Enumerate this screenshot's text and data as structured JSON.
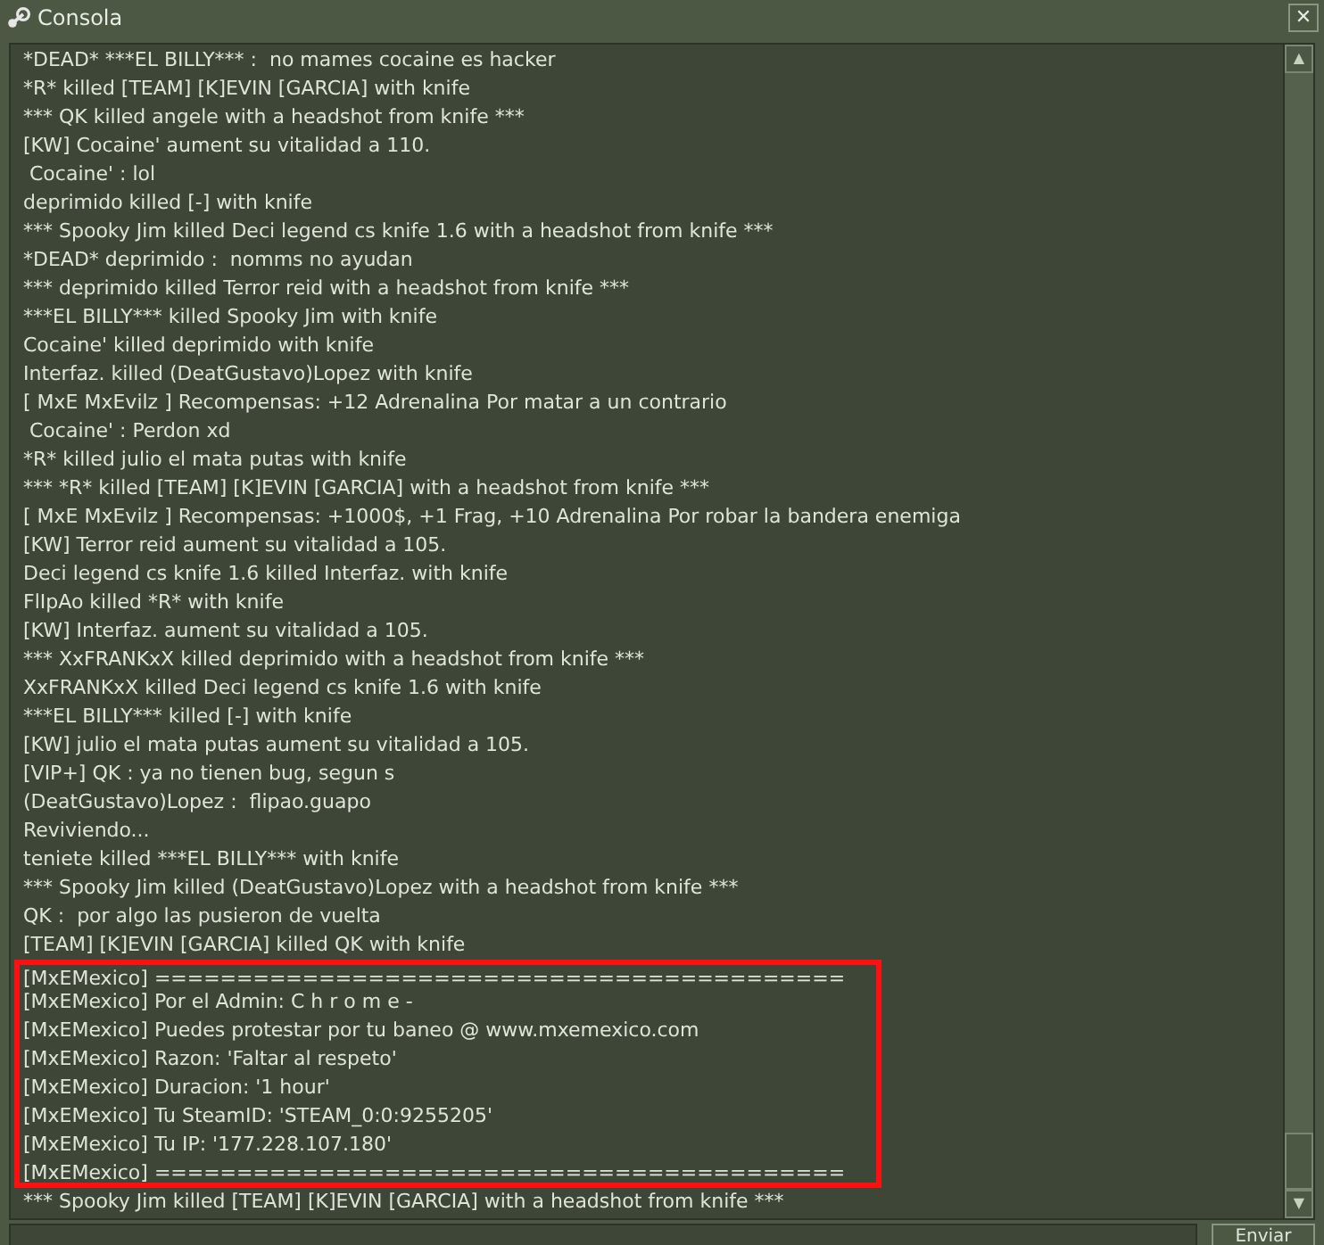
{
  "window": {
    "title": "Consola",
    "close": "✕"
  },
  "console_lines": [
    {
      "text": "*DEAD* ***EL BILLY*** :  no mames cocaine es hacker",
      "highlighted": false
    },
    {
      "text": "*R* killed [TEAM] [K]EVIN [GARCIA] with knife",
      "highlighted": false
    },
    {
      "text": "*** QK killed angele with a headshot from knife ***",
      "highlighted": false
    },
    {
      "text": "[KW] Cocaine' aument su vitalidad a 110.",
      "highlighted": false
    },
    {
      "text": " Cocaine' : lol",
      "highlighted": false
    },
    {
      "text": "deprimido killed [-] with knife",
      "highlighted": false
    },
    {
      "text": "*** Spooky Jim killed Deci legend cs knife 1.6 with a headshot from knife ***",
      "highlighted": false
    },
    {
      "text": "*DEAD* deprimido :  nomms no ayudan",
      "highlighted": false
    },
    {
      "text": "*** deprimido killed Terror reid with a headshot from knife ***",
      "highlighted": false
    },
    {
      "text": "***EL BILLY*** killed Spooky Jim with knife",
      "highlighted": false
    },
    {
      "text": "Cocaine' killed deprimido with knife",
      "highlighted": false
    },
    {
      "text": "Interfaz. killed (DeatGustavo)Lopez with knife",
      "highlighted": false
    },
    {
      "text": "[ MxE MxEvilz ] Recompensas: +12 Adrenalina Por matar a un contrario",
      "highlighted": false
    },
    {
      "text": " Cocaine' : Perdon xd",
      "highlighted": false
    },
    {
      "text": "*R* killed julio el mata putas with knife",
      "highlighted": false
    },
    {
      "text": "*** *R* killed [TEAM] [K]EVIN [GARCIA] with a headshot from knife ***",
      "highlighted": false
    },
    {
      "text": "[ MxE MxEvilz ] Recompensas: +1000$, +1 Frag, +10 Adrenalina Por robar la bandera enemiga",
      "highlighted": false
    },
    {
      "text": "[KW] Terror reid aument su vitalidad a 105.",
      "highlighted": false
    },
    {
      "text": "Deci legend cs knife 1.6 killed Interfaz. with knife",
      "highlighted": false
    },
    {
      "text": "FlIpAo killed *R* with knife",
      "highlighted": false
    },
    {
      "text": "[KW] Interfaz. aument su vitalidad a 105.",
      "highlighted": false
    },
    {
      "text": "*** XxFRANKxX killed deprimido with a headshot from knife ***",
      "highlighted": false
    },
    {
      "text": "XxFRANKxX killed Deci legend cs knife 1.6 with knife",
      "highlighted": false
    },
    {
      "text": "***EL BILLY*** killed [-] with knife",
      "highlighted": false
    },
    {
      "text": "[KW] julio el mata putas aument su vitalidad a 105.",
      "highlighted": false
    },
    {
      "text": "[VIP+] QK : ya no tienen bug, segun s",
      "highlighted": false
    },
    {
      "text": "(DeatGustavo)Lopez :  flipao.guapo",
      "highlighted": false
    },
    {
      "text": "Reviviendo...",
      "highlighted": false
    },
    {
      "text": "teniete killed ***EL BILLY*** with knife",
      "highlighted": false
    },
    {
      "text": "*** Spooky Jim killed (DeatGustavo)Lopez with a headshot from knife ***",
      "highlighted": false
    },
    {
      "text": "QK :  por algo las pusieron de vuelta",
      "highlighted": false
    },
    {
      "text": "[TEAM] [K]EVIN [GARCIA] killed QK with knife",
      "highlighted": false
    },
    {
      "text": "[MxEMexico] ==========================================",
      "highlighted": true
    },
    {
      "text": "[MxEMexico] Por el Admin: C h r o m e -",
      "highlighted": true
    },
    {
      "text": "[MxEMexico] Puedes protestar por tu baneo @ www.mxemexico.com",
      "highlighted": true
    },
    {
      "text": "[MxEMexico] Razon: 'Faltar al respeto'",
      "highlighted": true
    },
    {
      "text": "[MxEMexico] Duracion: '1 hour'",
      "highlighted": true
    },
    {
      "text": "[MxEMexico] Tu SteamID: 'STEAM_0:0:9255205'",
      "highlighted": true
    },
    {
      "text": "[MxEMexico] Tu IP: '177.228.107.180'",
      "highlighted": true
    },
    {
      "text": "[MxEMexico] ==========================================",
      "highlighted": true
    },
    {
      "text": "*** Spooky Jim killed [TEAM] [K]EVIN [GARCIA] with a headshot from knife ***",
      "highlighted": false
    }
  ],
  "scrollbar": {
    "up": "▲",
    "down": "▼"
  },
  "submit_button": {
    "label": "Enviar"
  }
}
